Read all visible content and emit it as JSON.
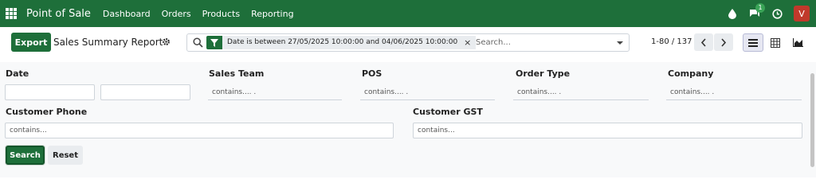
{
  "navbar": {
    "brand": "Point of Sale",
    "items": [
      "Dashboard",
      "Orders",
      "Products",
      "Reporting"
    ],
    "messages_badge": "1",
    "avatar_letter": "V",
    "icons": [
      "apps-icon",
      "drop-icon",
      "chat-icon",
      "clock-icon"
    ]
  },
  "control": {
    "export_label": "Export",
    "title": "Sales Summary Report",
    "facet_text": "Date is between 27/05/2025 10:00:00 and 04/06/2025 10:00:00",
    "facet_close": "×",
    "search_placeholder": "Search...",
    "pager": "1-80 / 137"
  },
  "filters": {
    "date_label": "Date",
    "sales_team_label": "Sales Team",
    "sales_team_placeholder": "contains.... .",
    "pos_label": "POS",
    "pos_placeholder": "contains.... .",
    "order_type_label": "Order Type",
    "order_type_placeholder": "contains.... .",
    "company_label": "Company",
    "company_placeholder": "contains.... .",
    "customer_phone_label": "Customer Phone",
    "customer_phone_placeholder": "contains...",
    "customer_gst_label": "Customer GST",
    "customer_gst_placeholder": "contains...",
    "search_label": "Search",
    "reset_label": "Reset"
  },
  "colors": {
    "brand_green": "#1e6f3a",
    "avatar_red": "#c0392b",
    "active_view": "#e6e7f2"
  }
}
